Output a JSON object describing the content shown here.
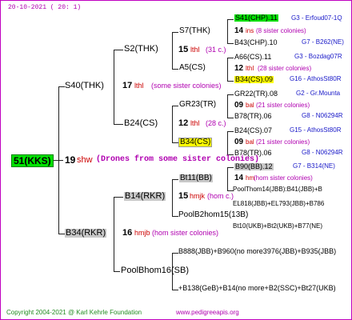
{
  "header": {
    "date": "20-10-2021 ( 20: 1)"
  },
  "root": {
    "id": "51(KKS)"
  },
  "gen1": {
    "num": "19",
    "code": "shw",
    "note": "(Drones from some sister colonies)"
  },
  "s40": {
    "id": "S40(THK)",
    "num": "17",
    "code": "lthl",
    "note": "(some sister colonies)"
  },
  "b34rkr": {
    "id": "B34(RKR)",
    "num": "16",
    "code": "hmjb",
    "note": "(hom sister colonies)"
  },
  "s2": {
    "id": "S2(THK)"
  },
  "b24": {
    "id": "B24(CS)"
  },
  "b14": {
    "id": "B14(RKR)",
    "num": "15",
    "code": "hmjk",
    "note": "(hom c.)"
  },
  "poolbhom": {
    "id": "PoolBhom16(SB)"
  },
  "s7": {
    "id": "S7(THK)",
    "num": "15",
    "code": "lthl",
    "note": "(31 c.)"
  },
  "a5": {
    "id": "A5(CS)"
  },
  "gr23": {
    "id": "GR23(TR)",
    "num": "12",
    "code": "lthl",
    "note": "(28 c.)"
  },
  "b34cs": {
    "id": "B34(CS)"
  },
  "bt11": {
    "id": "Bt11(BB)"
  },
  "poolb2": {
    "id": "PoolB2hom15(13B)"
  },
  "pb888": {
    "id": "B888(JBB)+B960(no more3976(JBB)+B935(JBB)"
  },
  "pb138": {
    "id": "+B138(GeB)+B14(no more+B2(SSC)+Bt27(UKB)"
  },
  "g5": {
    "r1": {
      "id": "S41(CHP).11",
      "ref": "G3 - Erfoud07-1Q"
    },
    "r2": {
      "num": "14",
      "code": "ins",
      "note": "(8 sister colonies)"
    },
    "r3": {
      "id": "B43(CHP).10",
      "ref": "G7 - B262(NE)"
    },
    "r4": {
      "id": "A66(CS).11",
      "ref": "G3 - Bozdag07R"
    },
    "r5": {
      "num": "12",
      "code": "lthl",
      "note": "(28 sister colonies)"
    },
    "r6": {
      "id": "B34(CS).09",
      "ref": "G16 - AthosSt80R"
    },
    "r7": {
      "id": "GR22(TR).08",
      "ref": "G2 - Gr.Mounta"
    },
    "r8": {
      "num": "09",
      "code": "bal",
      "note": "(21 sister colonies)"
    },
    "r9": {
      "id": "B78(TR).06",
      "ref": "G8 - N06294R"
    },
    "r10": {
      "id": "B24(CS).07",
      "ref": "G15 - AthosSt80R"
    },
    "r11": {
      "num": "09",
      "code": "bal",
      "note": "(21 sister colonies)"
    },
    "r12": {
      "id": "B78(TR).06",
      "ref": "G8 - N06294R"
    },
    "r13": {
      "id": "B90(BB).12",
      "ref": "G7 - B314(NE)"
    },
    "r14": {
      "num": "14",
      "code": "hm",
      "note": "(hom sister colonies)"
    },
    "r15": {
      "id": "PoolThom14(JBB):B41(JBB)+B"
    },
    "r16": {
      "id": "EL818(JBB)+EL793(JBB)+B786"
    },
    "r17": {
      "id": "Bt10(UKB)+Bt2(UKB)+B77(NE)"
    }
  },
  "footer": {
    "copyright": "Copyright 2004-2021 @ Karl Kehrle Foundation",
    "site": "www.pedigreeapis.org"
  }
}
